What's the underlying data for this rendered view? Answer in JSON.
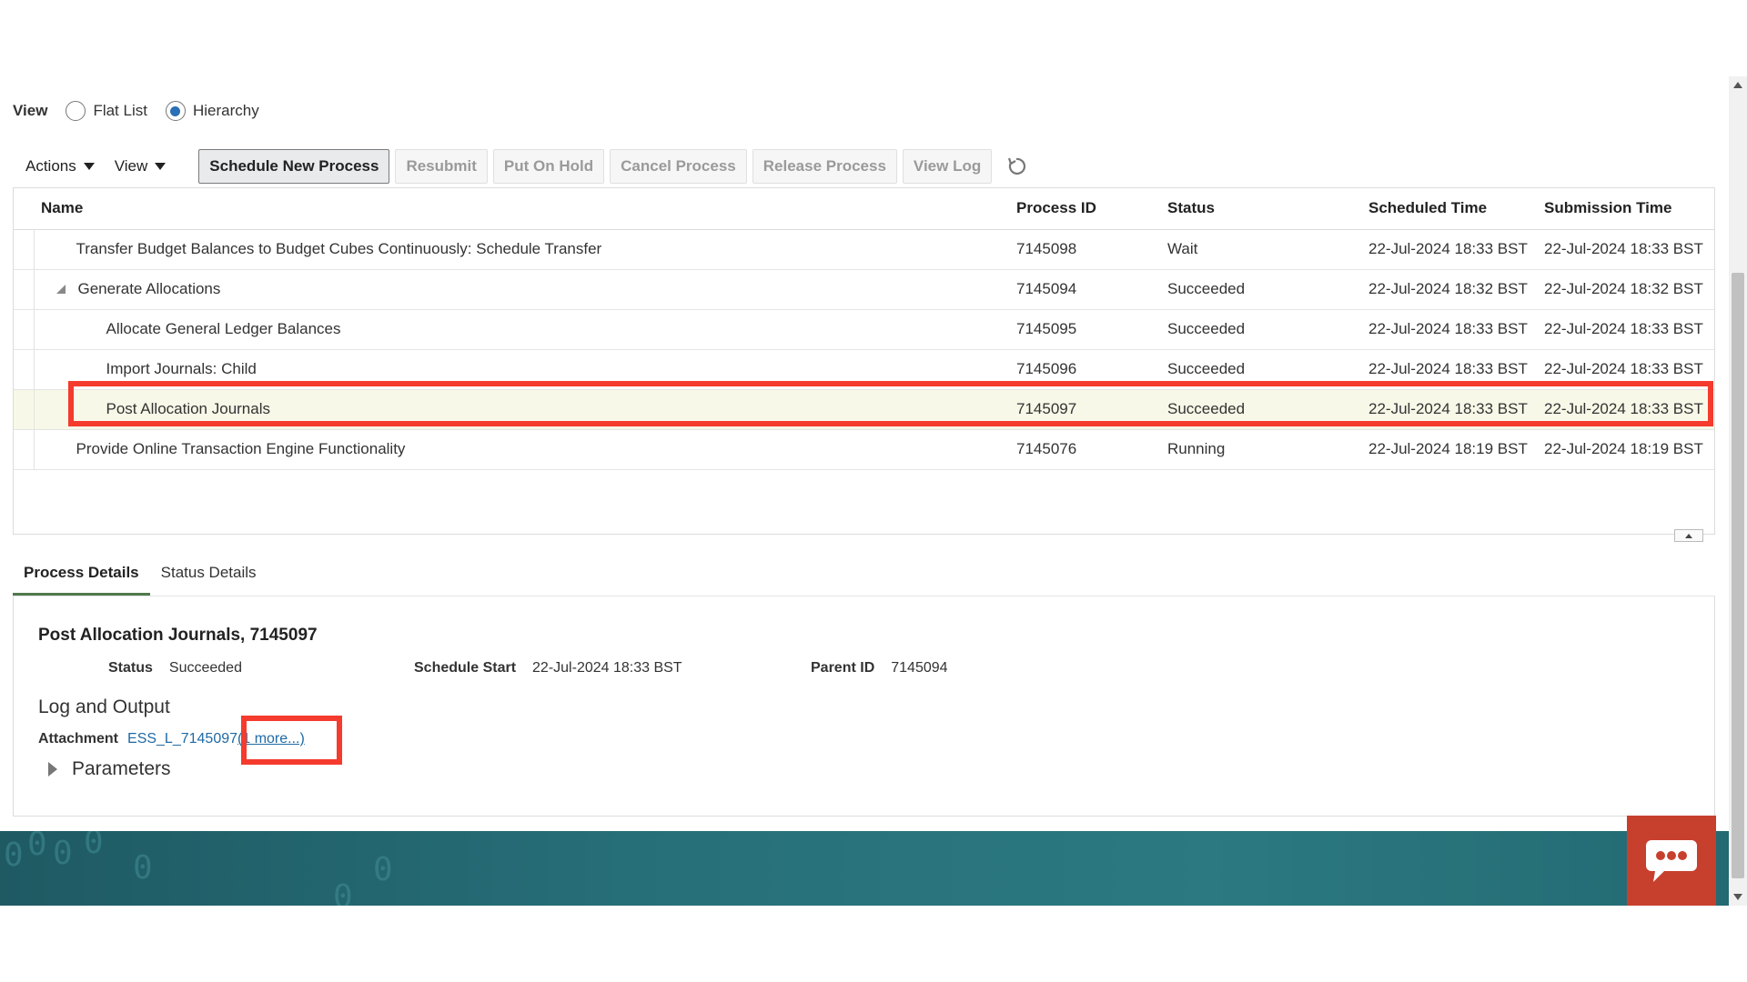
{
  "view_selector": {
    "label": "View",
    "options": [
      {
        "label": "Flat List",
        "checked": false
      },
      {
        "label": "Hierarchy",
        "checked": true
      }
    ]
  },
  "toolbar": {
    "actions_label": "Actions",
    "view_label": "View",
    "buttons": {
      "schedule_new_process": "Schedule New Process",
      "resubmit": "Resubmit",
      "put_on_hold": "Put On Hold",
      "cancel_process": "Cancel Process",
      "release_process": "Release Process",
      "view_log": "View Log"
    },
    "refresh_icon": "refresh-icon"
  },
  "table": {
    "columns": [
      "Name",
      "Process ID",
      "Status",
      "Scheduled Time",
      "Submission Time"
    ],
    "rows": [
      {
        "name": "Transfer Budget Balances to Budget Cubes Continuously: Schedule Transfer",
        "process_id": "7145098",
        "status": "Wait",
        "scheduled": "22-Jul-2024 18:33 BST",
        "submitted": "22-Jul-2024 18:33 BST"
      },
      {
        "name": "Generate Allocations",
        "process_id": "7145094",
        "status": "Succeeded",
        "scheduled": "22-Jul-2024 18:32 BST",
        "submitted": "22-Jul-2024 18:32 BST"
      },
      {
        "name": "Allocate General Ledger Balances",
        "process_id": "7145095",
        "status": "Succeeded",
        "scheduled": "22-Jul-2024 18:33 BST",
        "submitted": "22-Jul-2024 18:33 BST"
      },
      {
        "name": "Import Journals: Child",
        "process_id": "7145096",
        "status": "Succeeded",
        "scheduled": "22-Jul-2024 18:33 BST",
        "submitted": "22-Jul-2024 18:33 BST"
      },
      {
        "name": "Post Allocation Journals",
        "process_id": "7145097",
        "status": "Succeeded",
        "scheduled": "22-Jul-2024 18:33 BST",
        "submitted": "22-Jul-2024 18:33 BST"
      },
      {
        "name": "Provide Online Transaction Engine Functionality",
        "process_id": "7145076",
        "status": "Running",
        "scheduled": "22-Jul-2024 18:19 BST",
        "submitted": "22-Jul-2024 18:19 BST"
      }
    ]
  },
  "tabs": {
    "process_details": "Process Details",
    "status_details": "Status Details"
  },
  "details": {
    "title": "Post Allocation Journals, 7145097",
    "status_label": "Status",
    "status_value": "Succeeded",
    "schedule_start_label": "Schedule Start",
    "schedule_start_value": "22-Jul-2024 18:33 BST",
    "parent_id_label": "Parent ID",
    "parent_id_value": "7145094",
    "log_output_title": "Log and Output",
    "attachment_label": "Attachment",
    "attachment_link": "ESS_L_7145097",
    "more_link": "(1 more...)",
    "parameters_label": "Parameters"
  },
  "colors": {
    "highlight": "#f43b2e",
    "selected_row": "#f8f8e8",
    "active_tab": "#4f7a4b",
    "link": "#1f6aa5",
    "chat": "#c7402d",
    "footer": "#236a73"
  }
}
